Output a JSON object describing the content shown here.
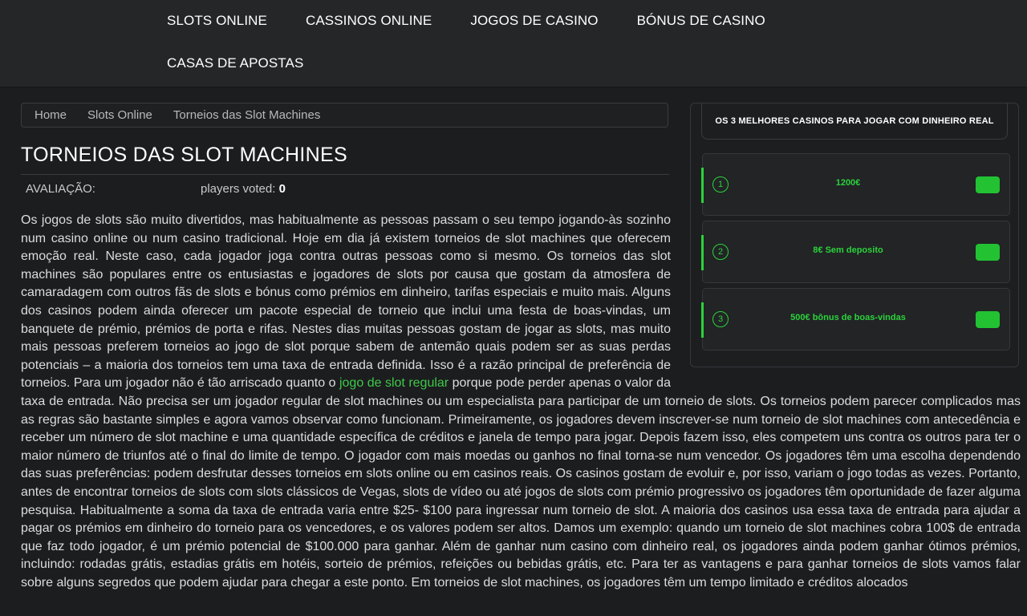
{
  "nav": {
    "items": [
      "SLOTS ONLINE",
      "CASSINOS ONLINE",
      "JOGOS DE CASINO",
      "BÓNUS DE CASINO",
      "CASAS DE APOSTAS"
    ]
  },
  "breadcrumb": [
    "Home",
    "Slots Online",
    "Torneios das Slot Machines"
  ],
  "page": {
    "title": "TORNEIOS DAS SLOT MACHINES",
    "rating_label": "AVALIAÇÃO:",
    "voted_label": "players voted:",
    "voted_count": "0"
  },
  "article": {
    "before_link": "Os jogos de slots são muito divertidos, mas habitualmente as pessoas passam o seu tempo jogando-às sozinho num casino online ou num casino tradicional. Hoje em dia já existem torneios de slot machines que oferecem emoção real. Neste caso, cada jogador joga contra outras pessoas como si mesmo. Os torneios das slot machines são populares entre os entusiastas e jogadores de slots por causa que gostam da atmosfera de camaradagem com outros fãs de slots e bónus como prémios em dinheiro, tarifas especiais e muito mais. Alguns dos casinos podem ainda oferecer um pacote especial de torneio que inclui uma festa de boas-vindas, um banquete de prémio, prémios de porta e rifas. Nestes dias muitas pessoas gostam de jogar as slots, mas muito mais pessoas preferem torneios ao jogo de slot porque sabem de antemão quais podem ser as suas perdas potenciais – a maioria dos torneios tem uma taxa de entrada definida. Isso é a razão principal de preferência de torneios. Para um jogador não é tão arriscado quanto o ",
    "link_text": "jogo de slot regular",
    "after_link": " porque pode perder apenas o valor da taxa de entrada. Não precisa ser um jogador regular de slot machines ou um especialista para participar de um torneio de slots. Os torneios podem parecer complicados mas as regras são bastante simples e agora vamos observar como funcionam. Primeiramente, os jogadores devem inscrever-se num torneio de slot machines com antecedência e receber um número de slot machine e uma quantidade específica de créditos e janela de tempo para jogar. Depois fazem isso, eles competem uns contra os outros para ter o maior número de triunfos até o final do limite de tempo. O jogador com mais moedas ou ganhos no final torna-se num vencedor. Os jogadores têm uma escolha dependendo das suas preferências: podem desfrutar desses torneios em slots online ou em casinos reais. Os casinos gostam de evoluir e, por isso, variam o jogo todas as vezes. Portanto, antes de encontrar torneios de slots com slots clássicos de Vegas, slots de vídeo ou até jogos de slots com prémio progressivo os jogadores têm oportunidade de fazer alguma pesquisa. Habitualmente a soma da taxa de entrada varia entre $25- $100 para ingressar num torneio de slot. A maioria dos casinos usa essa taxa de entrada para ajudar a pagar os prémios em dinheiro do torneio para os vencedores, e os valores podem ser altos. Damos um exemplo: quando um torneio de slot machines cobra 100$ de entrada que faz todo jogador, é um prémio potencial de $100.000 para ganhar. Além de ganhar num casino com dinheiro real, os jogadores ainda podem ganhar ótimos prémios, incluindo: rodadas grátis, estadias grátis em hotéis, sorteio de prémios, refeições ou bebidas grátis, etc. Para ter as vantagens e para ganhar torneios de slots vamos falar sobre alguns segredos que podem ajudar para chegar a este ponto. Em torneios de slot machines, os jogadores têm um tempo limitado e créditos alocados"
  },
  "sidebar": {
    "title": "OS 3 MELHORES CASINOS PARA JOGAR COM DINHEIRO REAL",
    "casinos": [
      {
        "rank": "1",
        "bonus": "1200€"
      },
      {
        "rank": "2",
        "bonus": "8€ Sem deposito"
      },
      {
        "rank": "3",
        "bonus": "500€ bônus de boas-vindas"
      }
    ]
  },
  "colors": {
    "accent": "#2bd23b",
    "link": "#3ec94a",
    "background": "#1c1d1f",
    "header": "#242628"
  }
}
